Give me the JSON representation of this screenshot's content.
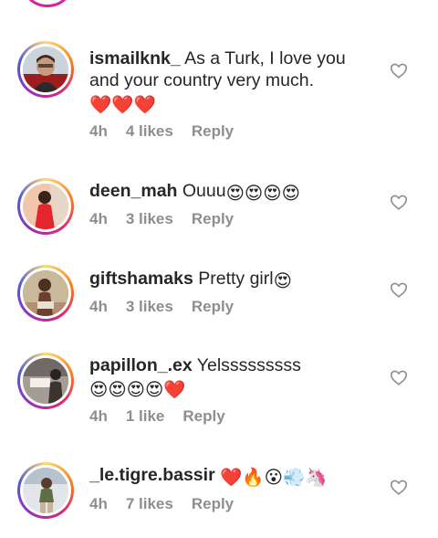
{
  "comments": [
    {
      "username": "ismailknk_",
      "text": "As a Turk, I love you and your country very much.",
      "emoji": "❤️❤️❤️",
      "time": "4h",
      "likes": "4 likes",
      "reply": "Reply"
    },
    {
      "username": "deen_mah",
      "text": "Ouuu",
      "emoji": "😍😍😍😍",
      "time": "4h",
      "likes": "3 likes",
      "reply": "Reply"
    },
    {
      "username": "giftshamaks",
      "text": "Pretty girl",
      "emoji": "😍",
      "time": "4h",
      "likes": "3 likes",
      "reply": "Reply"
    },
    {
      "username": "papillon_.ex",
      "text": "Yelsssssssss",
      "emoji": "😍😍😍😍❤️",
      "time": "4h",
      "likes": "1 like",
      "reply": "Reply"
    },
    {
      "username": "_le.tigre.bassir",
      "text": "",
      "emoji": "❤️🔥😮💨🦄",
      "time": "4h",
      "likes": "7 likes",
      "reply": "Reply"
    }
  ],
  "icons": {
    "like": "heart-outline-icon"
  }
}
